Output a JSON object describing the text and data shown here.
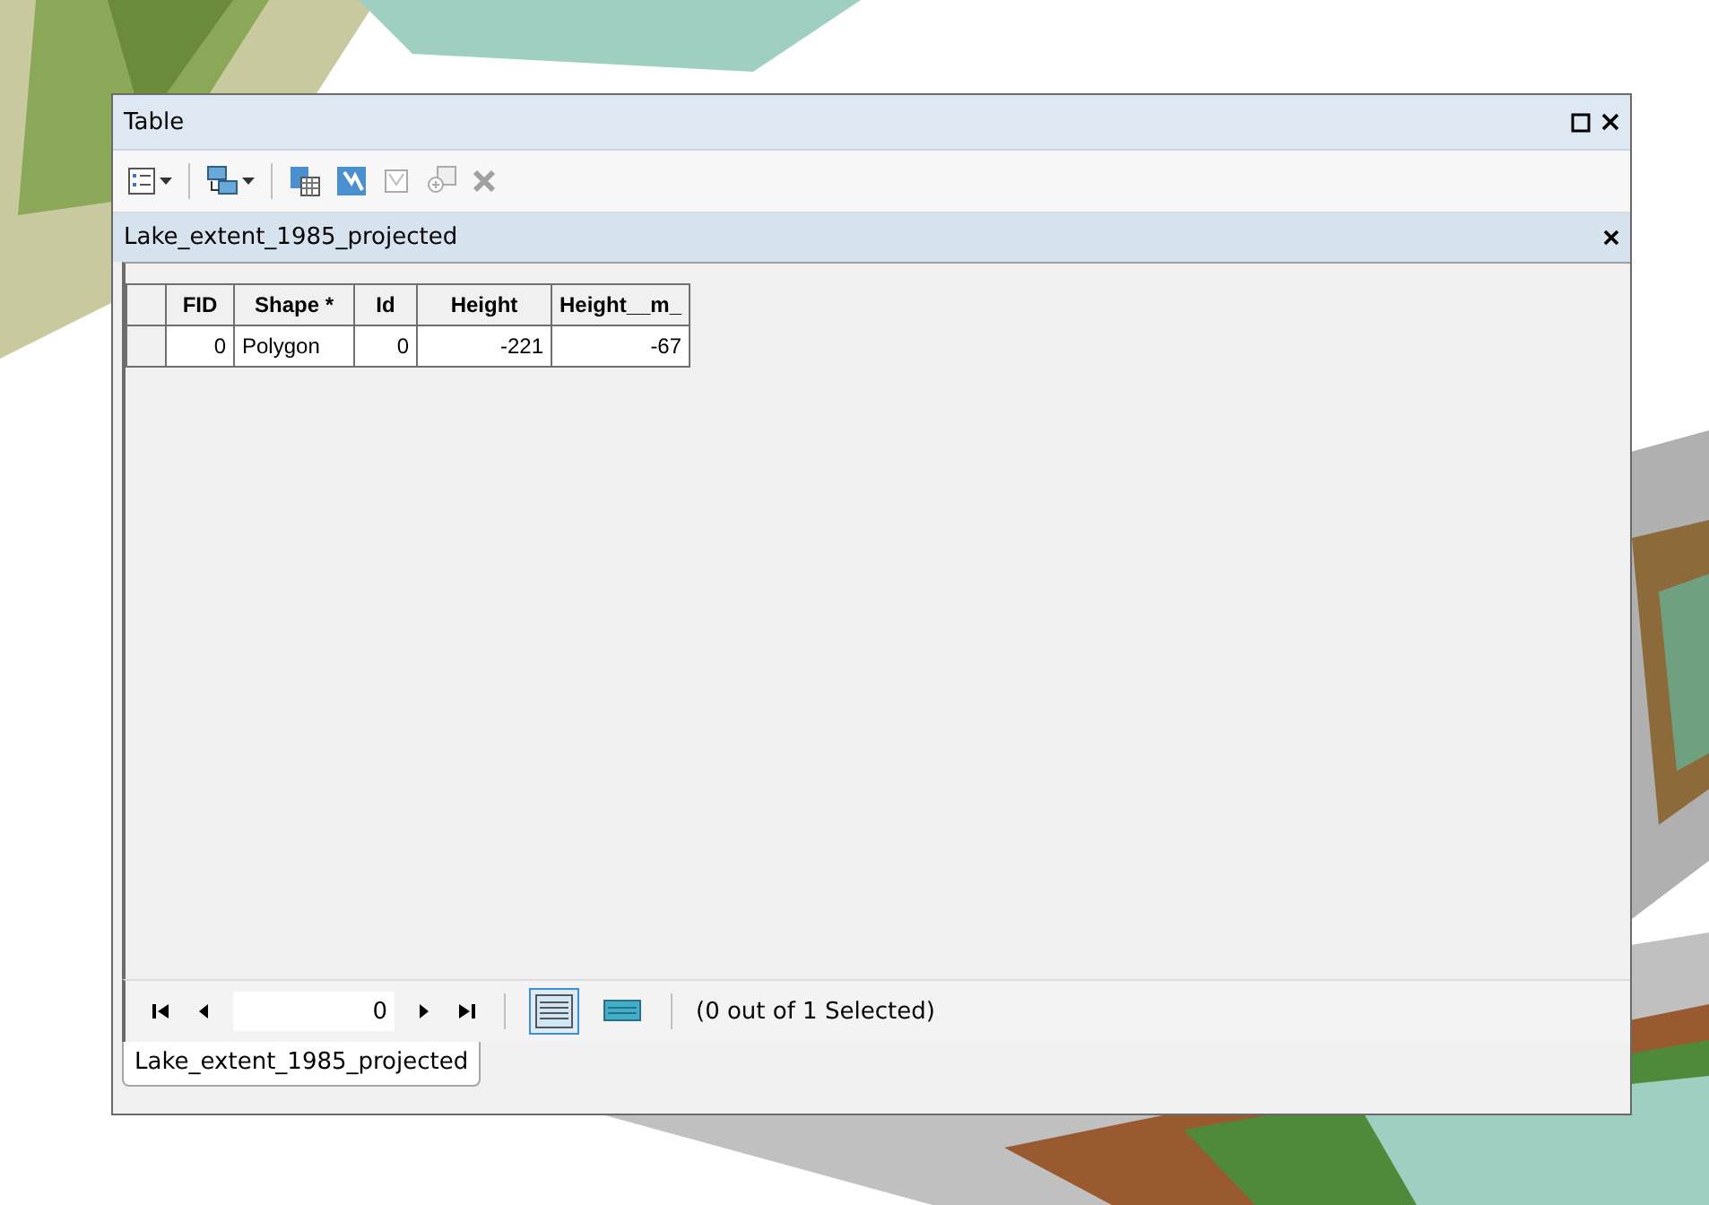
{
  "window": {
    "title": "Table"
  },
  "toolbar": {
    "items": [
      {
        "kind": "options",
        "dropdown": true
      },
      {
        "kind": "related",
        "dropdown": true
      },
      {
        "kind": "select-by",
        "dropdown": false
      },
      {
        "kind": "switch",
        "dropdown": false
      },
      {
        "kind": "clear",
        "dropdown": false
      },
      {
        "kind": "zoom",
        "dropdown": false
      },
      {
        "kind": "delete",
        "dropdown": false
      }
    ]
  },
  "layer_bar": {
    "title": "Lake_extent_1985_projected"
  },
  "table": {
    "columns": [
      {
        "label": "FID",
        "kind": "number"
      },
      {
        "label": "Shape *",
        "kind": "text"
      },
      {
        "label": "Id",
        "kind": "number"
      },
      {
        "label": "Height",
        "kind": "number"
      },
      {
        "label": "Height__m_",
        "kind": "number"
      }
    ],
    "rows": [
      {
        "selected": false,
        "cells": [
          "0",
          "Polygon",
          "0",
          "-221",
          "-67"
        ]
      }
    ]
  },
  "navigator": {
    "record": "0",
    "views": [
      {
        "kind": "all",
        "selected": true
      },
      {
        "kind": "selected",
        "selected": false
      }
    ],
    "status": "(0 out of 1 Selected)"
  },
  "tabs": [
    {
      "label": "Lake_extent_1985_projected",
      "selected": true
    }
  ]
}
